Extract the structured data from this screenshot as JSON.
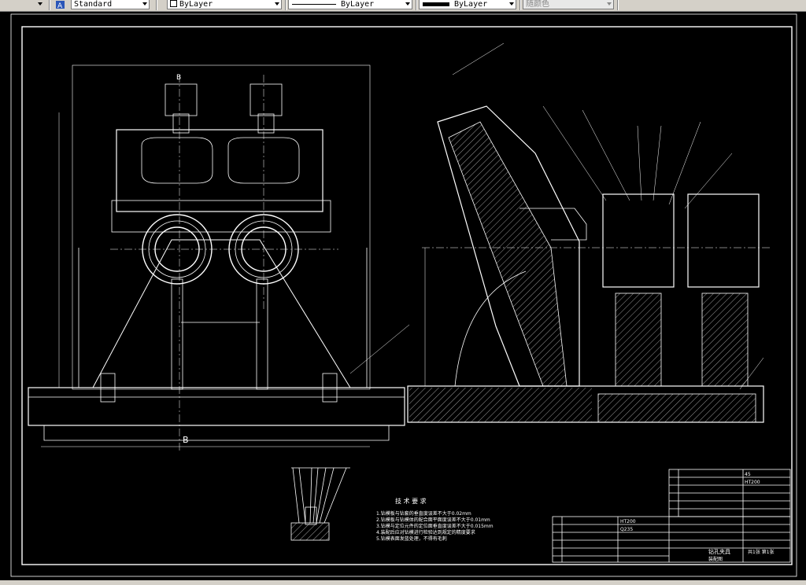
{
  "toolbar": {
    "text_style": "Standard",
    "layer": "ByLayer",
    "linetype": "ByLayer",
    "lineweight": "ByLayer",
    "plot_style": "随颜色"
  },
  "drawing": {
    "section_mark_top": "B",
    "section_mark_bottom": "B",
    "notes_title": "技 术 要 求",
    "notes": [
      "1.钻模板与钻套的垂直度误差不大于0.02mm",
      "2.钻模板与钻模体的配合面平面度误差不大于0.01mm",
      "3.钻模与定位元件的定位面垂直度误差不大于0.015mm",
      "4.装配后应对钻模进行检验达到规定的精度要求",
      "5.钻模表面发蓝处理，不得有毛刺"
    ],
    "material_ht200": "HT200",
    "material_45": "45",
    "material_q235": "Q235",
    "title_block_name": "钻孔夹具",
    "title_block_sheet": "共1张 第1张",
    "title_block_label": "装配图"
  },
  "colors": {
    "background": "#000000",
    "lines": "#ffffff",
    "toolbar": "#d4d0c8"
  }
}
